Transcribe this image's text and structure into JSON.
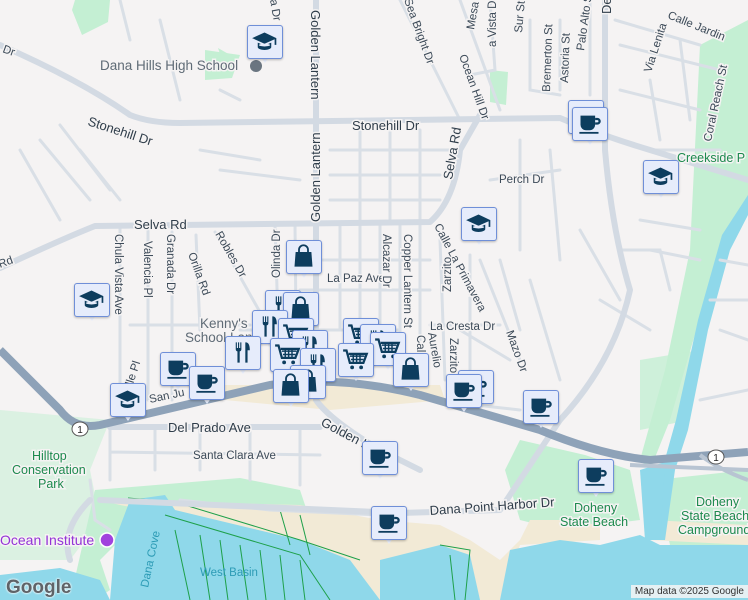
{
  "map": {
    "streets": {
      "stonehill": "Stonehill Dr",
      "stonehill_left": "Dr",
      "selva_rd": "Selva Rd",
      "selva_rd_left": "Rd",
      "selva_rd_vertical": "Selva Rd",
      "golden_lantern_1": "Golden Lantern",
      "golden_lantern_2": "Golden Lantern",
      "golden_lantern_lower": "Golden L",
      "del_prado": "Del Prado Ave",
      "santa_clara": "Santa Clara Ave",
      "san_juan": "San Ju",
      "dana_point_harbor": "Dana Point Harbor Dr",
      "la_paz": "La Paz Ave",
      "la_cresta": "La Cresta Dr",
      "perch": "Perch Dr",
      "chula_vista": "Chula Vista Ave",
      "valencia": "Valencia Pl",
      "granada": "Granada Dr",
      "orilla": "Orilla Rd",
      "robles": "Robles Dr",
      "olinda": "Olinda Dr",
      "alcazar": "Alcazar Dr",
      "copper_lantern": "Copper Lantern St",
      "calle_la_primavera": "Calle La Primavera",
      "zarzito": "Zarzito",
      "zarzito2": "Zarzito",
      "mazo": "Mazo Dr",
      "aurelio": "Aurelio",
      "calle": "Call",
      "sea_bright": "Sea Bright Dr",
      "ocean_hill": "Ocean Hill Dr",
      "mesa": "Mesa",
      "vista": "a Vista Dr",
      "sur": "Sur St",
      "bremerton": "Bremerton St",
      "astoria": "Astoria St",
      "palo_alto": "Palo Alto St",
      "del": "De",
      "calle_jardin": "Calle Jardin",
      "via_lenita": "Via Lenita",
      "coral_reach": "Coral Reach St",
      "seville": "eville Pl",
      "top_dr": "a Dr",
      "la_c": "La C",
      "highway_shield": "1"
    },
    "places": {
      "dana_hills_hs": "Dana Hills High School",
      "kennys": "Kenny's",
      "kennys2": "School Land",
      "hilltop_1": "Hilltop",
      "hilltop_2": "Conservation",
      "hilltop_3": "Park",
      "ocean_institute": "Ocean Institute",
      "dana_cove": "Dana Cove",
      "west_basin": "West Basin",
      "doheny_1": "Doheny",
      "doheny_2": "State Beach",
      "doheny_camp_1": "Doheny",
      "doheny_camp_2": "State Beach",
      "doheny_camp_3": "Campground",
      "creekside": "Creekside P"
    },
    "marker_types": [
      "school-icon",
      "coffee-icon",
      "shopping-bag-icon",
      "shopping-cart-icon",
      "restaurant-icon"
    ],
    "colors": {
      "background": "#f5f3f3",
      "road": "#d6dde5",
      "highway": "#8ea2b8",
      "water": "#8fd8ea",
      "park": "#c4efd3",
      "sand": "#f2ead6",
      "marker_fill": "#e6ecfb",
      "marker_border": "#6f8fd8",
      "marker_icon": "#0d3d5e"
    }
  },
  "footer": {
    "logo": "Google",
    "attribution": "Map data ©2025 Google"
  }
}
